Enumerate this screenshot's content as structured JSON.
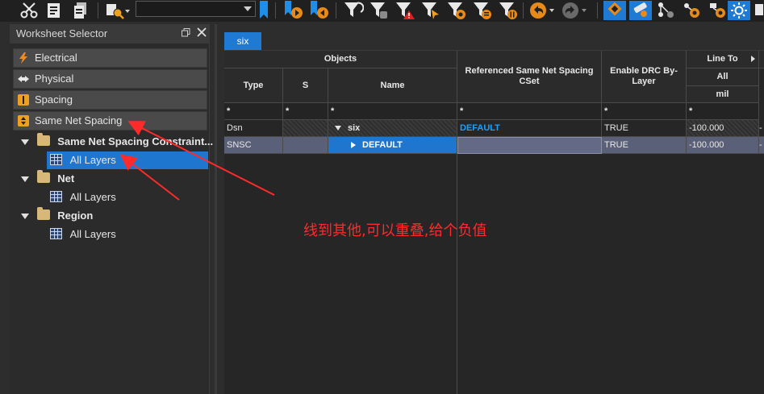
{
  "toolbar": {
    "combo_value": "",
    "icons": [
      "cut-icon",
      "paste-icon",
      "copy-icon",
      "search-icon",
      "bookmark-icon",
      "bookmark-next-icon",
      "bookmark-prev-icon",
      "filter-icon",
      "filter-add-icon",
      "filter-error-icon",
      "filter-select-icon",
      "filter-star-icon",
      "filter-list-icon",
      "filter-bars-icon",
      "undo-icon",
      "redo-icon",
      "highlight-icon",
      "tool-icon",
      "network-icon",
      "eye-icon",
      "eye-settings-icon",
      "sun-icon",
      "extra-icon"
    ]
  },
  "worksheet_selector": {
    "title": "Worksheet Selector",
    "categories": [
      {
        "label": "Electrical",
        "icon": "lightning-icon"
      },
      {
        "label": "Physical",
        "icon": "arrows-icon"
      },
      {
        "label": "Spacing",
        "icon": "spacing-icon"
      },
      {
        "label": "Same Net Spacing",
        "icon": "same-net-spacing-icon"
      }
    ],
    "tree": [
      {
        "label": "Same Net Spacing Constraint...",
        "children": [
          "All Layers"
        ]
      },
      {
        "label": "Net",
        "children": [
          "All Layers"
        ]
      },
      {
        "label": "Region",
        "children": [
          "All Layers"
        ]
      }
    ]
  },
  "tab": {
    "label": "six"
  },
  "grid": {
    "headers": {
      "objects": "Objects",
      "type": "Type",
      "s": "S",
      "name": "Name",
      "ref": "Referenced Same Net Spacing CSet",
      "drc": "Enable DRC By-Layer",
      "line_to": "Line To",
      "all": "All",
      "unit": "mil"
    },
    "filter": [
      "*",
      "*",
      "*",
      "*",
      "*",
      "*"
    ],
    "rows": [
      {
        "type": "Dsn",
        "s": "",
        "name": "six",
        "ref": "DEFAULT",
        "drc": "TRUE",
        "line_to": "-100.000",
        "more": "-"
      },
      {
        "type": "SNSC",
        "s": "",
        "name": "DEFAULT",
        "ref": "",
        "drc": "TRUE",
        "line_to": "-100.000",
        "more": "-"
      }
    ]
  },
  "annotation": {
    "text": "线到其他,可以重叠,给个负值",
    "color": "#ff2a2a"
  }
}
